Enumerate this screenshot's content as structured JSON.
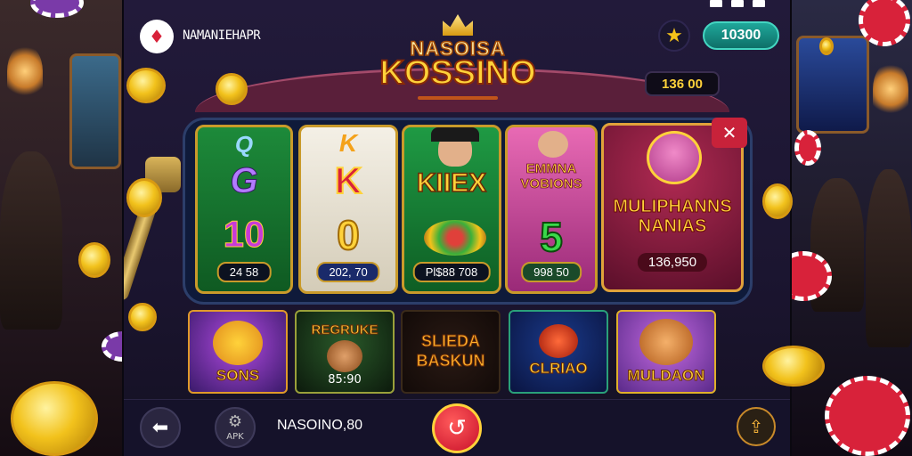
{
  "header": {
    "app_logo_glyph": "♦",
    "app_name": "NAMANIEHAPR",
    "star_glyph": "★",
    "balance": "10300",
    "logo_top": "NASOISA",
    "logo_main": "KOSSINO",
    "jackpot": "136 00"
  },
  "reels": [
    {
      "symbols": [
        "Q",
        "G",
        "10"
      ],
      "value": "24 58"
    },
    {
      "symbols": [
        "K",
        "K",
        "0"
      ],
      "value": "202, 70"
    },
    {
      "symbols": [
        "KIIEX"
      ],
      "value": "Pl$88 708"
    },
    {
      "symbols": [
        "EMMNA VOBIONS",
        "5"
      ],
      "value": "998 50"
    },
    {
      "symbols": [
        "MULIPHANNS NANIAS"
      ],
      "value": "136,950"
    }
  ],
  "close_glyph": "✕",
  "games": [
    {
      "label": "SONS"
    },
    {
      "label": "REGRUKE",
      "sub": "85:90"
    },
    {
      "label": "SLIEDA BASKUN"
    },
    {
      "label": "CLRIAO"
    },
    {
      "label": "MULDAON"
    }
  ],
  "nav": {
    "back_glyph": "⬅",
    "apk_label": "APK",
    "apk_glyph": "⚙",
    "site": "NASOINO,80",
    "spin_glyph": "↺",
    "exit_glyph": "⇪"
  },
  "colors": {
    "accent_gold": "#ffd23a",
    "balance_teal": "#1fa79a",
    "spin_red": "#c8102a"
  }
}
